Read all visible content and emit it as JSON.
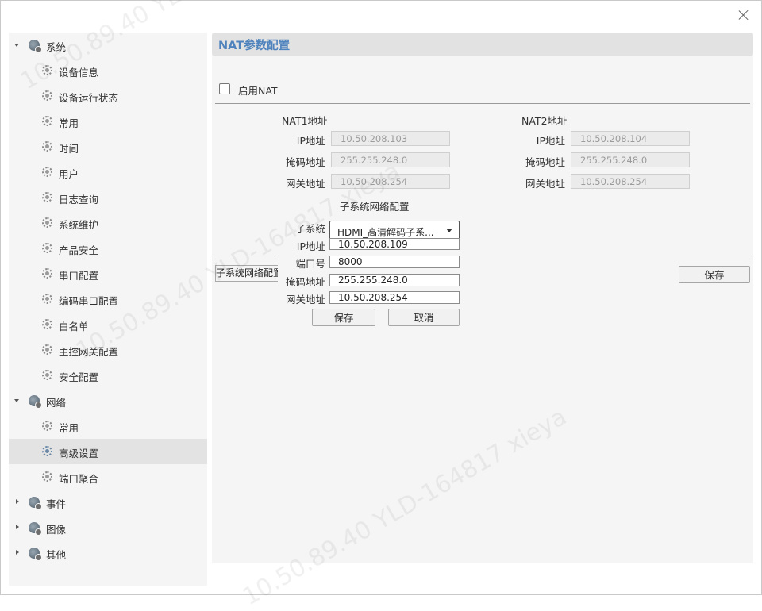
{
  "sidebar": {
    "items": [
      {
        "label": "系统",
        "level": 1,
        "expanded": true
      },
      {
        "label": "设备信息",
        "level": 2
      },
      {
        "label": "设备运行状态",
        "level": 2
      },
      {
        "label": "常用",
        "level": 2
      },
      {
        "label": "时间",
        "level": 2
      },
      {
        "label": "用户",
        "level": 2
      },
      {
        "label": "日志查询",
        "level": 2
      },
      {
        "label": "系统维护",
        "level": 2
      },
      {
        "label": "产品安全",
        "level": 2
      },
      {
        "label": "串口配置",
        "level": 2
      },
      {
        "label": "编码串口配置",
        "level": 2
      },
      {
        "label": "白名单",
        "level": 2
      },
      {
        "label": "主控网关配置",
        "level": 2
      },
      {
        "label": "安全配置",
        "level": 2
      },
      {
        "label": "网络",
        "level": 1,
        "expanded": true
      },
      {
        "label": "常用",
        "level": 2
      },
      {
        "label": "高级设置",
        "level": 2,
        "selected": true
      },
      {
        "label": "端口聚合",
        "level": 2
      },
      {
        "label": "事件",
        "level": 1,
        "expanded": false
      },
      {
        "label": "图像",
        "level": 1,
        "expanded": false
      },
      {
        "label": "其他",
        "level": 1,
        "expanded": false
      }
    ]
  },
  "page": {
    "title": "NAT参数配置",
    "enable_nat_label": "启用NAT",
    "nat1": {
      "heading": "NAT1地址",
      "ip_label": "IP地址",
      "ip": "10.50.208.103",
      "mask_label": "掩码地址",
      "mask": "255.255.248.0",
      "gateway_label": "网关地址",
      "gateway": "10.50.208.254"
    },
    "nat2": {
      "heading": "NAT2地址",
      "ip_label": "IP地址",
      "ip": "10.50.208.104",
      "mask_label": "掩码地址",
      "mask": "255.255.248.0",
      "gateway_label": "网关地址",
      "gateway": "10.50.208.254"
    },
    "save_label": "保存",
    "subsystem_tab_label": "子系统网络配置"
  },
  "popup": {
    "title": "子系统网络配置",
    "subsystem_label": "子系统",
    "subsystem_value": "HDMI_高清解码子系...",
    "ip_label": "IP地址",
    "ip": "10.50.208.109",
    "port_label": "端口号",
    "port": "8000",
    "mask_label": "掩码地址",
    "mask": "255.255.248.0",
    "gateway_label": "网关地址",
    "gateway": "10.50.208.254",
    "save_label": "保存",
    "cancel_label": "取消"
  },
  "watermark": "10.50.89.40  YLD-164817  xieya",
  "colors": {
    "accent": "#4f83bd",
    "panel": "#f5f5f5",
    "selected": "#e3e3e3"
  }
}
